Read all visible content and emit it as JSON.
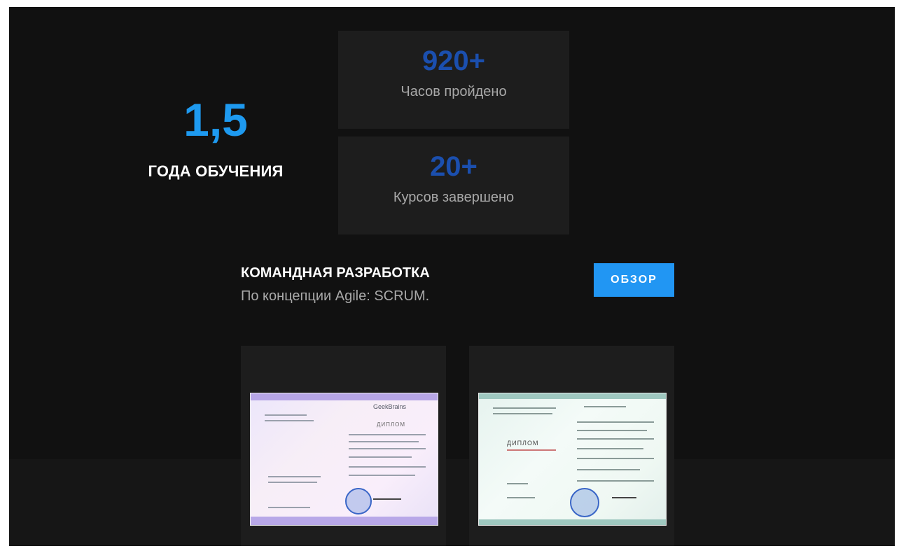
{
  "stats": {
    "big": {
      "value": "1,5",
      "label": "ГОДА ОБУЧЕНИЯ"
    },
    "hours": {
      "value": "920+",
      "label": "Часов пройдено"
    },
    "courses": {
      "value": "20+",
      "label": "Курсов завершено"
    }
  },
  "course": {
    "title": "КОМАНДНАЯ РАЗРАБОТКА",
    "subtitle": "По концепции Agile: SCRUM.",
    "button_label": "ОБЗОР"
  },
  "certificates": {
    "first": {
      "brand": "GeekBrains",
      "doc_title": "ДИПЛОМ"
    },
    "second": {
      "doc_title": "ДИПЛОМ"
    }
  },
  "colors": {
    "page_bg": "#111111",
    "card_bg": "#1d1d1d",
    "accent_blue": "#1e9af0",
    "dark_blue": "#1b4fae",
    "button_blue": "#2196f3"
  }
}
